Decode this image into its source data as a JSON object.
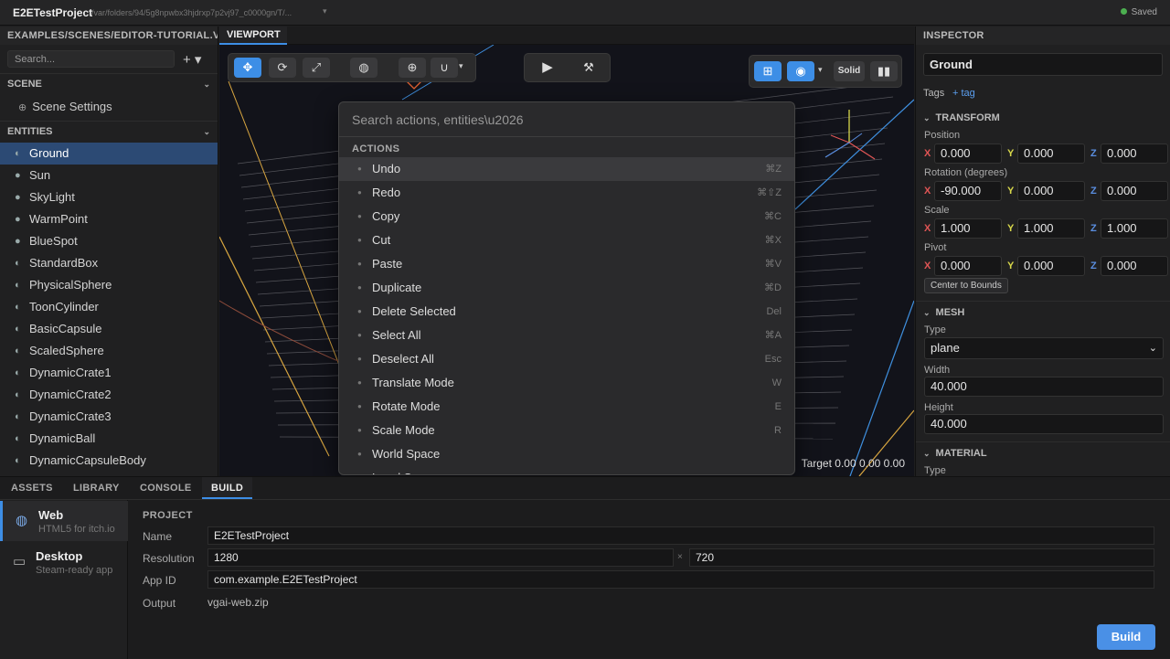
{
  "titlebar": {
    "app": "E2ETestProject",
    "path": "/var/folders/94/5g8npwbx3hjdrxp7p2vj97_c0000gn/T/...",
    "saved": "Saved"
  },
  "left": {
    "path": "EXAMPLES/SCENES/EDITOR-TUTORIAL.VS",
    "search_placeholder": "Search...",
    "plus": "+ ▾",
    "scene_header": "SCENE",
    "scene_settings": "Scene Settings",
    "entities_header": "ENTITIES",
    "entities": [
      {
        "label": "Ground",
        "icon": "mesh-icon"
      },
      {
        "label": "Sun",
        "icon": "light-icon"
      },
      {
        "label": "SkyLight",
        "icon": "light-icon"
      },
      {
        "label": "WarmPoint",
        "icon": "light-icon"
      },
      {
        "label": "BlueSpot",
        "icon": "light-icon"
      },
      {
        "label": "StandardBox",
        "icon": "mesh-icon"
      },
      {
        "label": "PhysicalSphere",
        "icon": "mesh-icon"
      },
      {
        "label": "ToonCylinder",
        "icon": "mesh-icon"
      },
      {
        "label": "BasicCapsule",
        "icon": "mesh-icon"
      },
      {
        "label": "ScaledSphere",
        "icon": "mesh-icon"
      },
      {
        "label": "DynamicCrate1",
        "icon": "mesh-icon"
      },
      {
        "label": "DynamicCrate2",
        "icon": "mesh-icon"
      },
      {
        "label": "DynamicCrate3",
        "icon": "mesh-icon"
      },
      {
        "label": "DynamicBall",
        "icon": "mesh-icon"
      },
      {
        "label": "DynamicCapsuleBody",
        "icon": "mesh-icon"
      }
    ]
  },
  "viewport": {
    "tab": "VIEWPORT",
    "solid": "Solid",
    "target": "Target 0.00 0.00 0.00"
  },
  "palette": {
    "placeholder": "Search actions, entities\\u2026",
    "section": "ACTIONS",
    "items": [
      {
        "label": "Undo",
        "key": "⌘Z"
      },
      {
        "label": "Redo",
        "key": "⌘⇧Z"
      },
      {
        "label": "Copy",
        "key": "⌘C"
      },
      {
        "label": "Cut",
        "key": "⌘X"
      },
      {
        "label": "Paste",
        "key": "⌘V"
      },
      {
        "label": "Duplicate",
        "key": "⌘D"
      },
      {
        "label": "Delete Selected",
        "key": "Del"
      },
      {
        "label": "Select All",
        "key": "⌘A"
      },
      {
        "label": "Deselect All",
        "key": "Esc"
      },
      {
        "label": "Translate Mode",
        "key": "W"
      },
      {
        "label": "Rotate Mode",
        "key": "E"
      },
      {
        "label": "Scale Mode",
        "key": "R"
      },
      {
        "label": "World Space",
        "key": ""
      },
      {
        "label": "Local Space",
        "key": ""
      }
    ]
  },
  "inspector": {
    "header": "INSPECTOR",
    "name": "Ground",
    "tags": "Tags",
    "add_tag": "+ tag",
    "transform": "TRANSFORM",
    "position_label": "Position",
    "position": {
      "x": "0.000",
      "y": "0.000",
      "z": "0.000"
    },
    "rotation_label": "Rotation (degrees)",
    "rotation": {
      "x": "-90.000",
      "y": "0.000",
      "z": "0.000"
    },
    "scale_label": "Scale",
    "scale": {
      "x": "1.000",
      "y": "1.000",
      "z": "1.000"
    },
    "pivot_label": "Pivot",
    "pivot": {
      "x": "0.000",
      "y": "0.000",
      "z": "0.000"
    },
    "center_button": "Center to Bounds",
    "mesh": "MESH",
    "type_label": "Type",
    "type_value": "plane",
    "width_label": "Width",
    "width": "40.000",
    "height_label": "Height",
    "height": "40.000",
    "material": "MATERIAL",
    "material_type_label": "Type",
    "x": "X",
    "y": "Y",
    "z": "Z"
  },
  "bottom": {
    "tabs": [
      "ASSETS",
      "LIBRARY",
      "CONSOLE",
      "BUILD"
    ],
    "targets": [
      {
        "name": "Web",
        "sub": "HTML5 for itch.io"
      },
      {
        "name": "Desktop",
        "sub": "Steam-ready app"
      }
    ],
    "section": "PROJECT",
    "name_label": "Name",
    "name": "E2ETestProject",
    "res_label": "Resolution",
    "res_w": "1280",
    "res_sep": "×",
    "res_h": "720",
    "appid_label": "App ID",
    "appid": "com.example.E2ETestProject",
    "output_label": "Output",
    "output": "vgai-web.zip",
    "build": "Build"
  }
}
